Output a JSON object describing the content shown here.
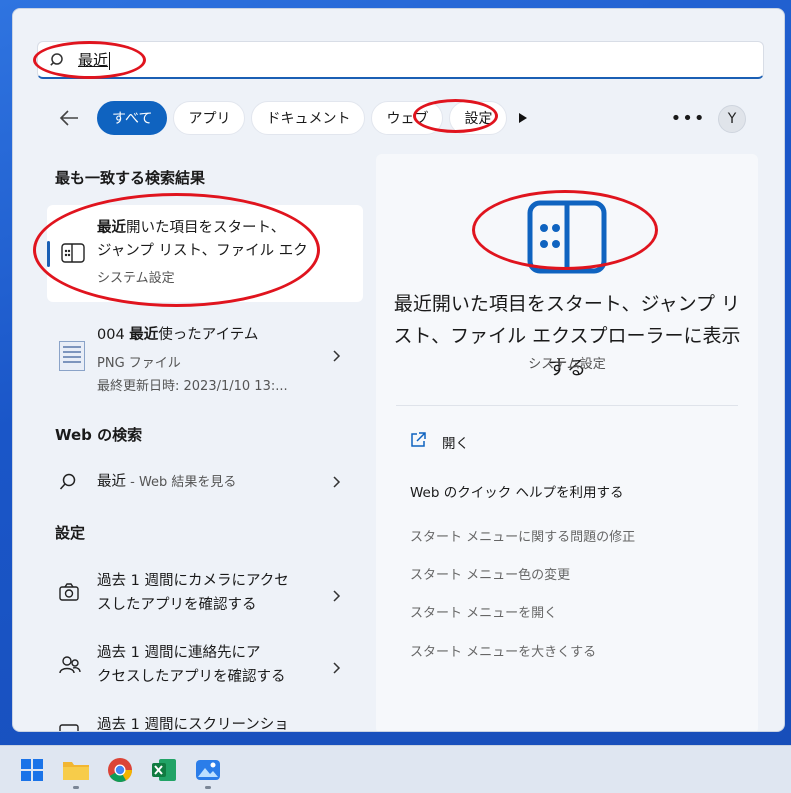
{
  "search": {
    "query": "最近"
  },
  "filters": {
    "all": "すべて",
    "apps": "アプリ",
    "documents": "ドキュメント",
    "web": "ウェブ",
    "settings": "設定",
    "avatar_letter": "Y"
  },
  "best_match": {
    "section_title": "最も一致する検索結果",
    "title_bold": "最近",
    "title_rest_line1": "開いた項目をスタート、",
    "title_line2": "ジャンプ リスト、ファイル エク",
    "subtitle": "システム設定"
  },
  "file_result": {
    "prefix": "004 ",
    "title_bold": "最近",
    "title_rest": "使ったアイテム",
    "type": "PNG ファイル",
    "modified": "最終更新日時: 2023/1/10 13:..."
  },
  "web_section": {
    "title": "Web の検索",
    "query": "最近",
    "hint": " - Web 結果を見る"
  },
  "settings_section": {
    "title": "設定",
    "items": [
      {
        "line1": "過去 1 週間にカメラにアクセ",
        "line2": "スしたアプリを確認する"
      },
      {
        "line1": "過去 1 週間に連絡先にア",
        "line2": "クセスしたアプリを確認する"
      },
      {
        "line1": "過去 1 週間にスクリーンショ",
        "line2": ""
      }
    ]
  },
  "preview": {
    "title": "最近開いた項目をスタート、ジャンプ リスト、ファイル エクスプローラーに表示する",
    "subtitle": "システム設定",
    "open": "開く",
    "help": "Web のクイック ヘルプを利用する",
    "links": [
      "スタート メニューに関する問題の修正",
      "スタート メニュー色の変更",
      "スタート メニューを開く",
      "スタート メニューを大きくする"
    ]
  },
  "colors": {
    "accent": "#0f63c0",
    "annotation": "#e0141e",
    "panel": "#eef2f8"
  }
}
